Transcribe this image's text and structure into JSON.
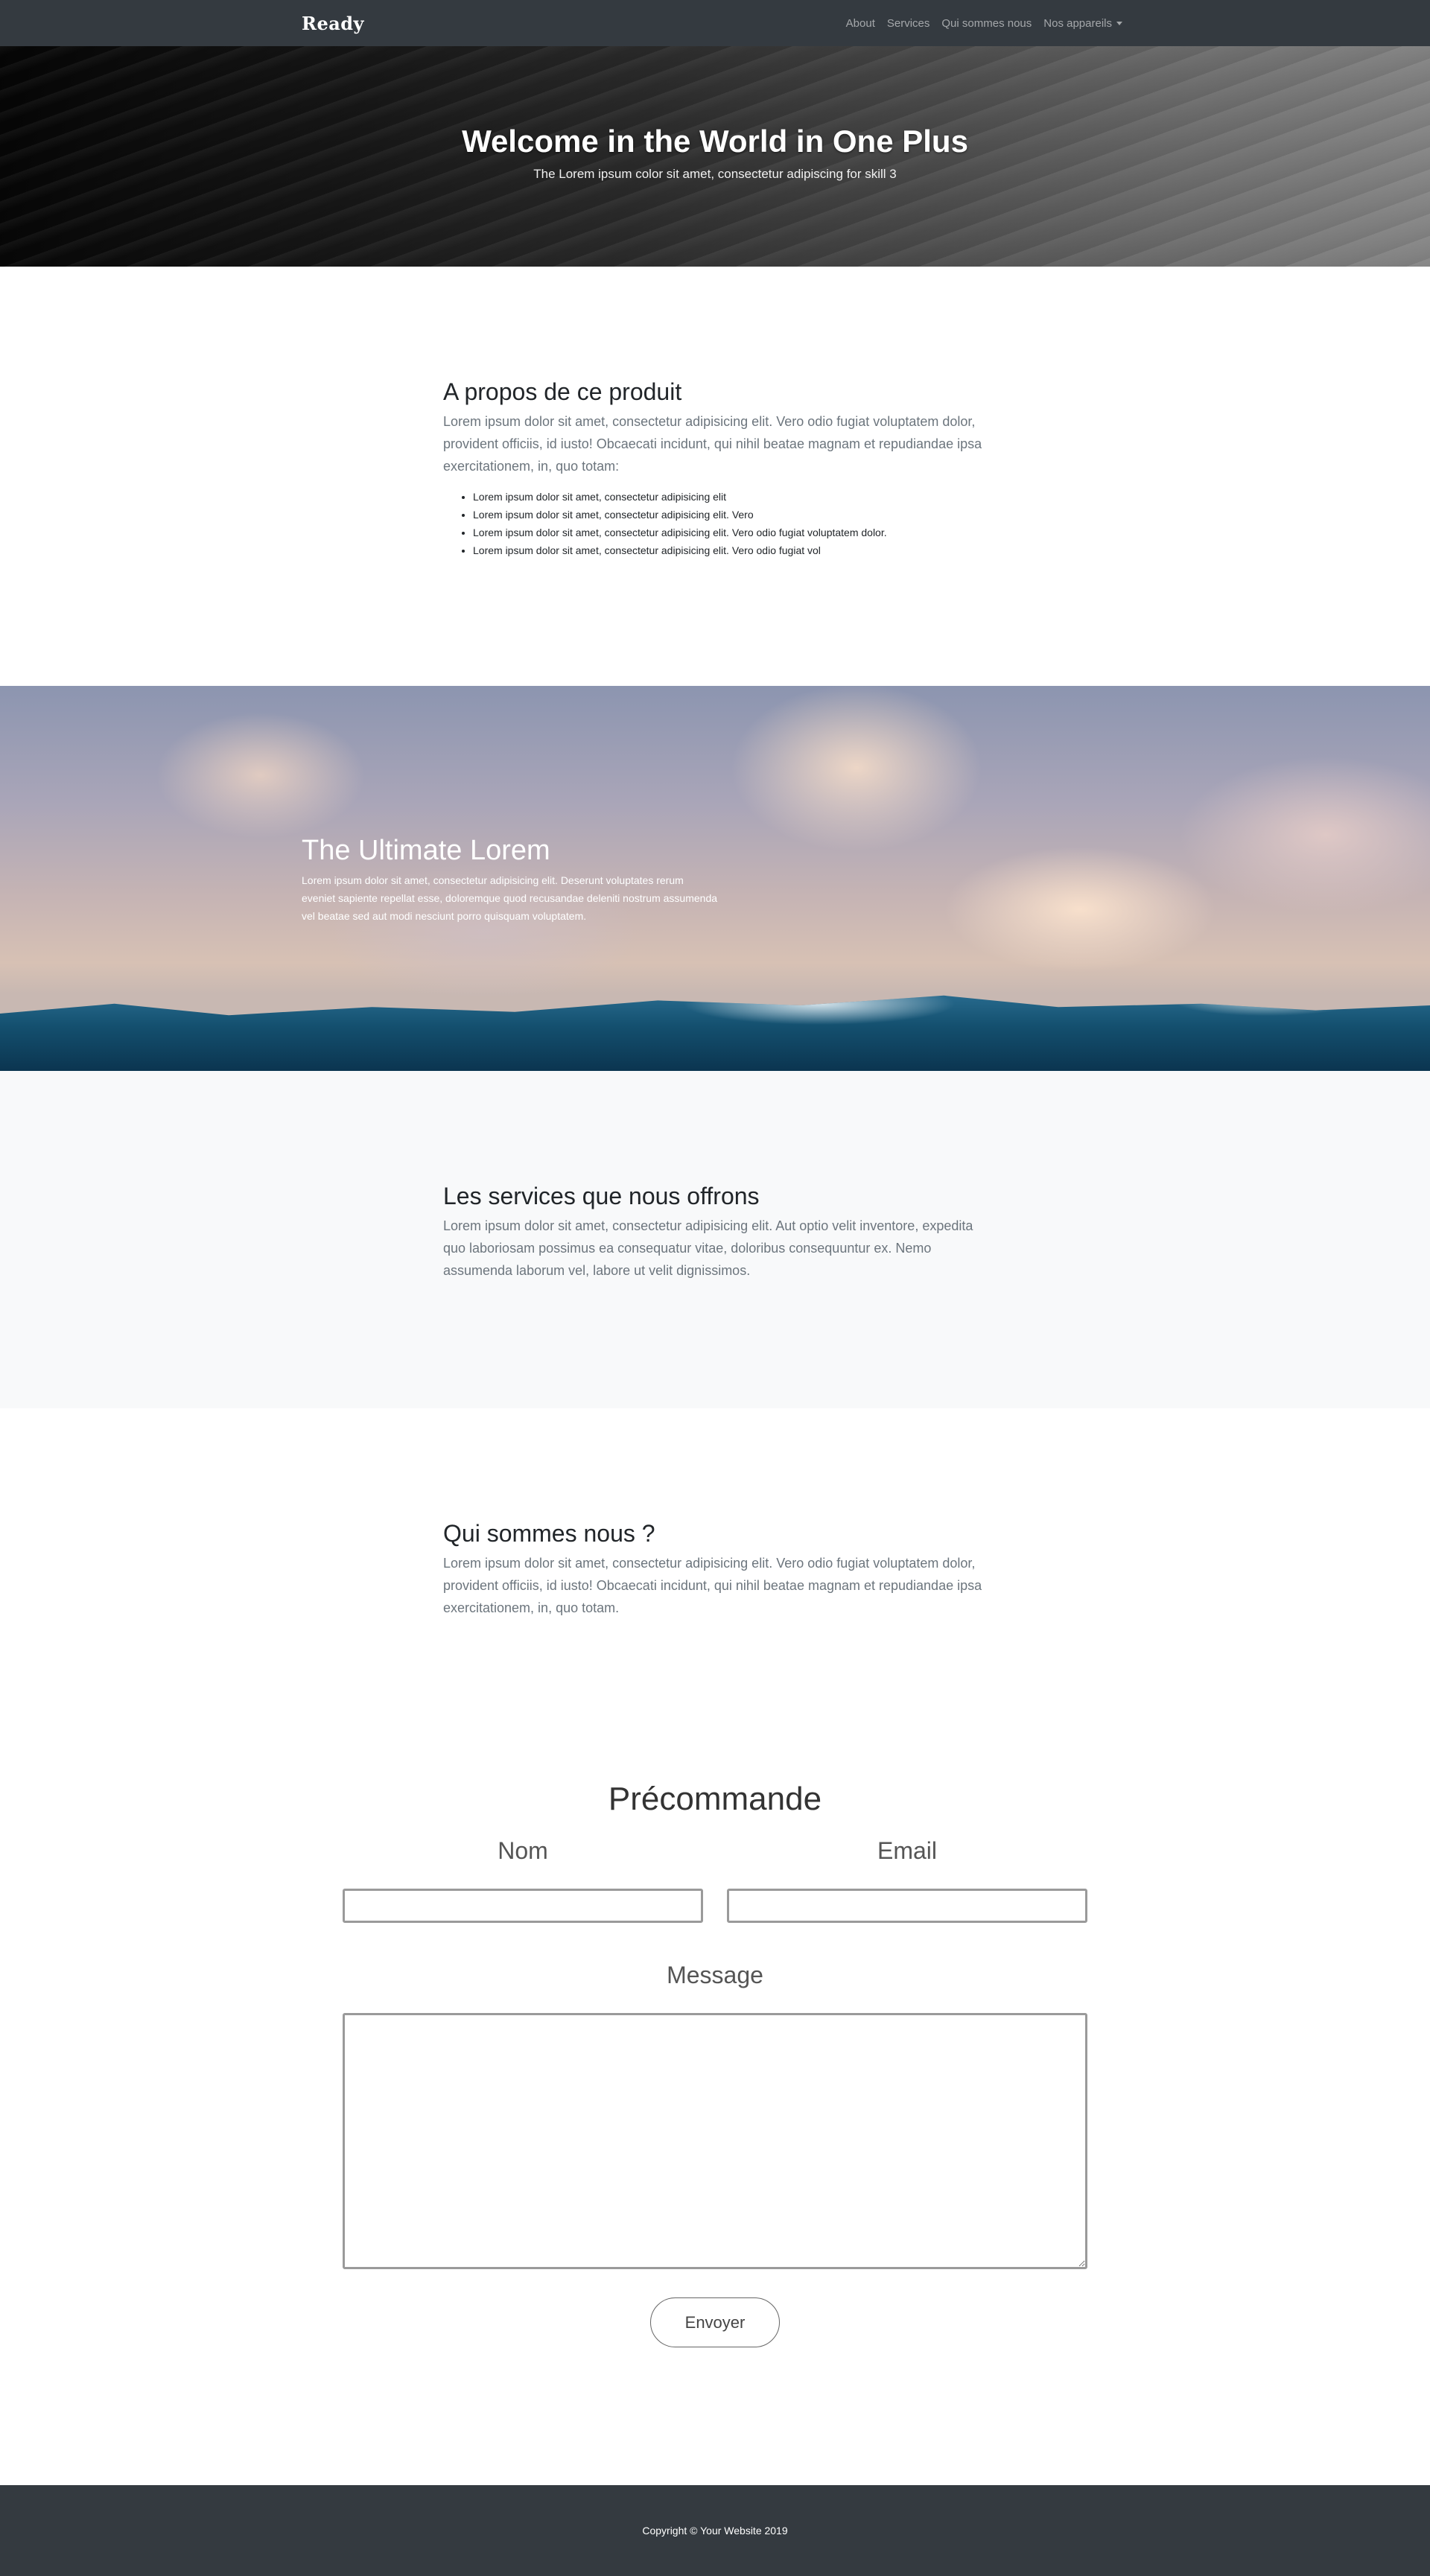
{
  "navbar": {
    "brand": "Ready",
    "links": [
      "About",
      "Services",
      "Qui sommes nous",
      "Nos appareils"
    ]
  },
  "hero": {
    "title": "Welcome in the World in One Plus",
    "subtitle": "The Lorem ipsum color sit amet, consectetur adipiscing for skill 3"
  },
  "about": {
    "title": "A propos de ce produit",
    "text": "Lorem ipsum dolor sit amet, consectetur adipisicing elit. Vero odio fugiat voluptatem dolor, provident officiis, id iusto! Obcaecati incidunt, qui nihil beatae magnam et repudiandae ipsa exercitationem, in, quo totam:",
    "bullets": [
      "Lorem ipsum dolor sit amet, consectetur adipisicing elit",
      "Lorem ipsum dolor sit amet, consectetur adipisicing elit. Vero",
      "Lorem ipsum dolor sit amet, consectetur adipisicing elit. Vero odio fugiat voluptatem dolor.",
      "Lorem ipsum dolor sit amet, consectetur adipisicing elit. Vero odio fugiat vol"
    ]
  },
  "parallax": {
    "title": "The Ultimate Lorem",
    "text": "Lorem ipsum dolor sit amet, consectetur adipisicing elit. Deserunt voluptates rerum eveniet sapiente repellat esse, doloremque quod recusandae deleniti nostrum assumenda vel beatae sed aut modi nesciunt porro quisquam voluptatem."
  },
  "services": {
    "title": "Les services que nous offrons",
    "text": "Lorem ipsum dolor sit amet, consectetur adipisicing elit. Aut optio velit inventore, expedita quo laboriosam possimus ea consequatur vitae, doloribus consequuntur ex. Nemo assumenda laborum vel, labore ut velit dignissimos."
  },
  "who": {
    "title": "Qui sommes nous ?",
    "text": "Lorem ipsum dolor sit amet, consectetur adipisicing elit. Vero odio fugiat voluptatem dolor, provident officiis, id iusto! Obcaecati incidunt, qui nihil beatae magnam et repudiandae ipsa exercitationem, in, quo totam."
  },
  "order": {
    "title": "Précommande",
    "name_label": "Nom",
    "email_label": "Email",
    "message_label": "Message",
    "name_value": "",
    "email_value": "",
    "message_value": "",
    "submit_label": "Envoyer"
  },
  "footer": {
    "copyright": "Copyright © Your Website 2019"
  }
}
